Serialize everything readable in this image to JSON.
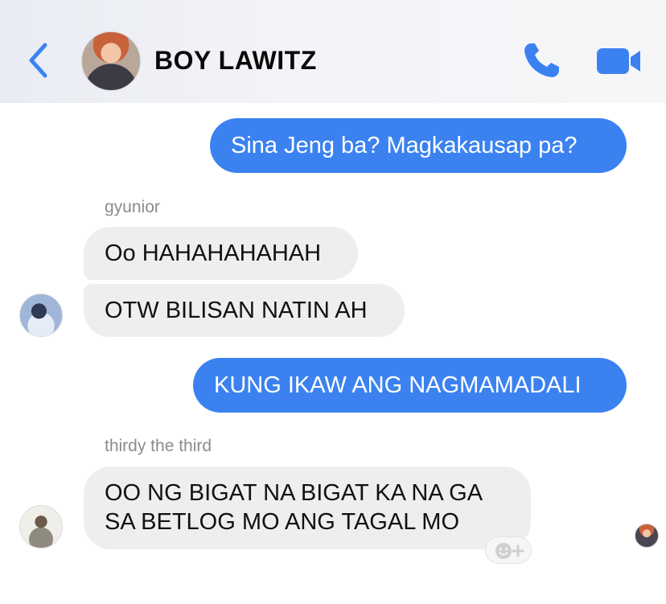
{
  "header": {
    "contact_name": "BOY LAWITZ"
  },
  "colors": {
    "accent": "#3b82f0",
    "incoming_bubble": "#eeeeef",
    "sender_label": "#8c8c8c"
  },
  "icons": {
    "back": "chevron-left-icon",
    "call": "phone-icon",
    "video": "video-camera-icon",
    "react": "add-reaction-icon"
  },
  "messages": [
    {
      "direction": "outgoing",
      "text": "Sina Jeng ba? Magkakausap pa?"
    },
    {
      "direction": "incoming",
      "sender": "gyunior",
      "text": "Oo HAHAHAHAHAH"
    },
    {
      "direction": "incoming",
      "text": "OTW BILISAN NATIN AH"
    },
    {
      "direction": "outgoing",
      "text": "KUNG IKAW ANG NAGMAMADALI"
    },
    {
      "direction": "incoming",
      "sender": "thirdy the third",
      "lines": [
        "OO NG BIGAT NA BIGAT KA NA GA",
        "SA BETLOG MO ANG TAGAL MO"
      ]
    }
  ]
}
